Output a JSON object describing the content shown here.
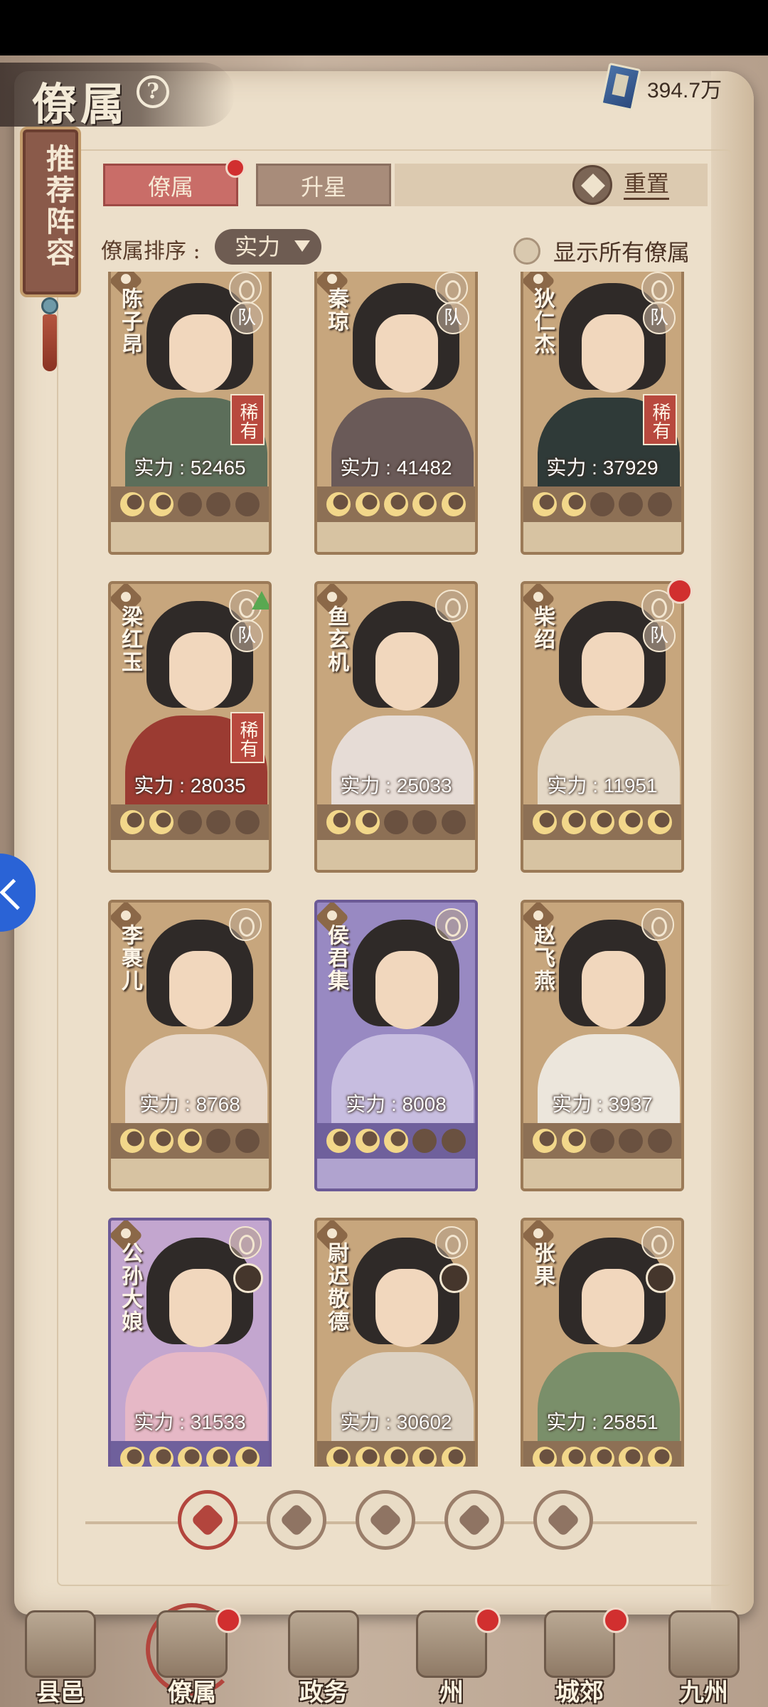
{
  "header": {
    "title": "僚属",
    "currency_value": "394.7万"
  },
  "side_tab": {
    "label": "推荐阵容"
  },
  "tabs": [
    {
      "label": "僚属",
      "active": true,
      "badge": true
    },
    {
      "label": "升星",
      "active": false,
      "badge": false
    }
  ],
  "reset_label": "重置",
  "sort": {
    "label": "僚属排序 :",
    "value": "实力"
  },
  "show_all": {
    "label": "显示所有僚属",
    "checked": false
  },
  "cards": [
    {
      "name": "陈子昂",
      "power": "实力 : 52465",
      "stars": 2,
      "rare": "稀有",
      "team": "队",
      "theme": "tan",
      "badge": false,
      "up": false,
      "portrait": false,
      "body": "#5c6e5a"
    },
    {
      "name": "秦琼",
      "power": "实力 : 41482",
      "stars": 5,
      "rare": "",
      "team": "队",
      "theme": "tan",
      "badge": false,
      "up": false,
      "portrait": false,
      "body": "#6a5a58"
    },
    {
      "name": "狄仁杰",
      "power": "实力 : 37929",
      "stars": 2,
      "rare": "稀有",
      "team": "队",
      "theme": "tan",
      "badge": false,
      "up": false,
      "portrait": false,
      "body": "#2f3a38"
    },
    {
      "name": "梁红玉",
      "power": "实力 : 28035",
      "stars": 2,
      "rare": "稀有",
      "team": "队",
      "theme": "tan",
      "badge": false,
      "up": true,
      "portrait": false,
      "body": "#9b3b32"
    },
    {
      "name": "鱼玄机",
      "power": "实力 : 25033",
      "stars": 2,
      "rare": "",
      "team": "",
      "theme": "tan",
      "badge": false,
      "up": false,
      "portrait": false,
      "body": "#e6dcd6"
    },
    {
      "name": "柴绍",
      "power": "实力 : 11951",
      "stars": 5,
      "rare": "",
      "team": "队",
      "theme": "tan",
      "badge": true,
      "up": false,
      "portrait": false,
      "body": "#e4d8c6"
    },
    {
      "name": "李裹儿",
      "power": "实力 : 8768",
      "stars": 3,
      "rare": "",
      "team": "",
      "theme": "tan",
      "badge": false,
      "up": false,
      "portrait": false,
      "body": "#e8d8c8"
    },
    {
      "name": "侯君集",
      "power": "实力 : 8008",
      "stars": 3,
      "rare": "",
      "team": "",
      "theme": "purple",
      "badge": false,
      "up": false,
      "portrait": false,
      "body": "#c7bde0"
    },
    {
      "name": "赵飞燕",
      "power": "实力 : 3937",
      "stars": 2,
      "rare": "",
      "team": "",
      "theme": "tan",
      "badge": false,
      "up": false,
      "portrait": false,
      "body": "#ece6dc"
    },
    {
      "name": "公孙大娘",
      "power": "实力 : 31533",
      "stars": 5,
      "rare": "",
      "team": "",
      "theme": "pinkpurple",
      "badge": false,
      "up": false,
      "portrait": true,
      "body": "#e6b8c6"
    },
    {
      "name": "尉迟敬德",
      "power": "实力 : 30602",
      "stars": 5,
      "rare": "",
      "team": "",
      "theme": "tan",
      "badge": false,
      "up": false,
      "portrait": true,
      "body": "#ddd2c2"
    },
    {
      "name": "张果",
      "power": "实力 : 25851",
      "stars": 5,
      "rare": "",
      "team": "",
      "theme": "tan",
      "badge": false,
      "up": false,
      "portrait": true,
      "body": "#7a8f6a"
    }
  ],
  "filters": [
    {
      "name": "all-filter",
      "active": true
    },
    {
      "name": "civil-filter",
      "active": false
    },
    {
      "name": "scholar-filter",
      "active": false
    },
    {
      "name": "fan-filter",
      "active": false
    },
    {
      "name": "beast-filter",
      "active": false
    }
  ],
  "nav": [
    {
      "label": "县邑",
      "badge": false,
      "active": false
    },
    {
      "label": "僚属",
      "badge": true,
      "active": true
    },
    {
      "label": "政务",
      "badge": false,
      "active": false
    },
    {
      "label": "州",
      "badge": true,
      "active": false
    },
    {
      "label": "城郊",
      "badge": true,
      "active": false
    },
    {
      "label": "九州",
      "badge": false,
      "active": false
    }
  ]
}
